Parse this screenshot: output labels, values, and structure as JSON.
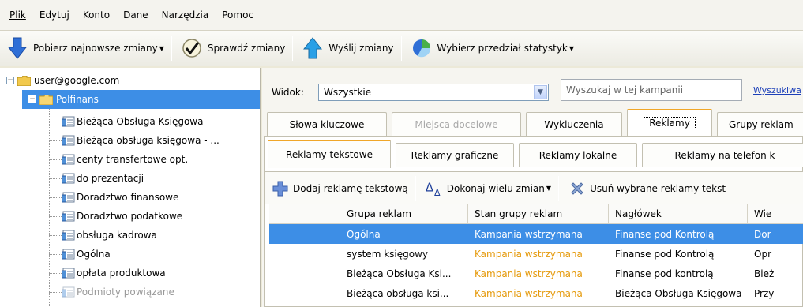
{
  "menu": [
    "Plik",
    "Edytuj",
    "Konto",
    "Dane",
    "Narzędzia",
    "Pomoc"
  ],
  "toolbar": {
    "download": "Pobierz najnowsze zmiany",
    "check": "Sprawdź zmiany",
    "send": "Wyślij zmiany",
    "stats": "Wybierz przedział statystyk"
  },
  "tree": {
    "account": "user@google.com",
    "campaign": "Polfinans",
    "groups": [
      "Bieżąca Obsługa Księgowa",
      "Bieżąca obsługa księgowa - ...",
      "centy transfertowe opt.",
      "do prezentacji",
      "Doradztwo finansowe",
      "Doradztwo podatkowe",
      "obsługa kadrowa",
      "Ogólna",
      "opłata produktowa",
      "Podmioty powiązane"
    ]
  },
  "filter": {
    "view_label": "Widok:",
    "view_value": "Wszystkie",
    "search_placeholder": "Wyszukaj w tej kampanii",
    "search_link": "Wyszukiwa"
  },
  "tabs": [
    "Słowa kluczowe",
    "Miejsca docelowe",
    "Wykluczenia",
    "Reklamy",
    "Grupy reklam"
  ],
  "subtabs": [
    "Reklamy tekstowe",
    "Reklamy graficzne",
    "Reklamy lokalne",
    "Reklamy na telefon k"
  ],
  "actions": {
    "add": "Dodaj reklamę tekstową",
    "multi": "Dokonaj wielu zmian",
    "delete": "Usuń wybrane reklamy tekst"
  },
  "table": {
    "headers": [
      "",
      "Grupa reklam",
      "Stan grupy reklam",
      "Nagłówek",
      "Wie"
    ],
    "rows": [
      [
        "",
        "Ogólna",
        "Kampania wstrzymana",
        "Finanse pod Kontrolą",
        "Dor"
      ],
      [
        "",
        "system księgowy",
        "Kampania wstrzymana",
        "Finanse pod Kontrolą",
        "Opr"
      ],
      [
        "",
        "Bieżąca Obsługa Ksi...",
        "Kampania wstrzymana",
        "Finanse pod kontrolą",
        "Bież"
      ],
      [
        "",
        "Bieżąca obsługa ksi...",
        "Kampania wstrzymana",
        "Bieżąca Obsługa Księgowa",
        "Przy"
      ]
    ]
  },
  "colors": {
    "selection": "#3d8ee6",
    "status_orange": "#e59a0c",
    "tab_accent": "#f0a628"
  }
}
